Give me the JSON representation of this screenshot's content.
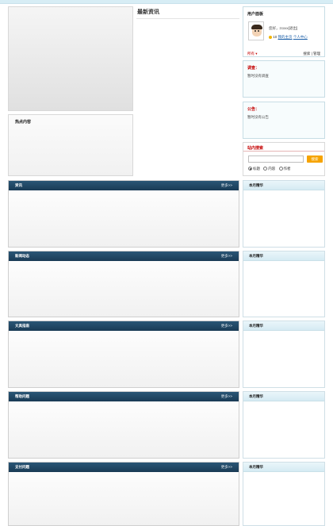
{
  "hot": {
    "title": "热点内容"
  },
  "news": {
    "title": "最新资讯"
  },
  "user_panel": {
    "title": "用户面板",
    "greeting": "您好，zcxxx[退出]",
    "coin_count": "10",
    "link_my_home": "我的主页",
    "link_personal_center": "个人中心",
    "friends_label": "所有",
    "tools": "搜索 | 管理"
  },
  "survey": {
    "title": "调查：",
    "body": "暂时没有调查"
  },
  "notice": {
    "title": "公告：",
    "body": "暂时没有公告"
  },
  "search": {
    "title": "站内搜索",
    "placeholder": "",
    "button_label": "搜索",
    "options": [
      "标题",
      "内容",
      "作者"
    ],
    "selected_index": 0
  },
  "sections": [
    {
      "title": "资讯",
      "more": "更多>>",
      "side_title": "本月精华"
    },
    {
      "title": "新闻动态",
      "more": "更多>>",
      "side_title": "本月精华"
    },
    {
      "title": "文具指南",
      "more": "更多>>",
      "side_title": "本月精华"
    },
    {
      "title": "帮助问题",
      "more": "更多>>",
      "side_title": "本月精华"
    },
    {
      "title": "支付问题",
      "more": "更多>>",
      "side_title": "本月精华"
    }
  ],
  "colors": {
    "section_bar": "#1f4766",
    "accent_red": "#c40000",
    "search_button": "#f6a300",
    "link": "#1a5ea8"
  }
}
